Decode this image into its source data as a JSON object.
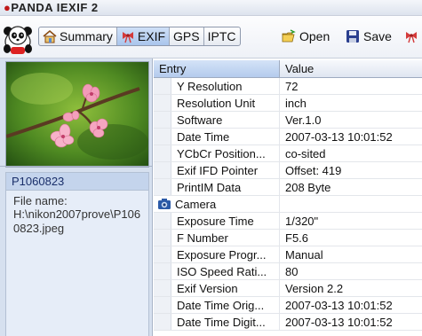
{
  "app": {
    "title_mark": "●",
    "title_text": "PANDA IEXIF 2"
  },
  "toolbar": {
    "tabs": [
      {
        "label": "Summary",
        "icon": "home-icon",
        "active": false
      },
      {
        "label": "EXIF",
        "icon": "exif-bow-icon",
        "active": true
      },
      {
        "label": "GPS",
        "icon": "",
        "active": false
      },
      {
        "label": "IPTC",
        "icon": "",
        "active": false
      }
    ],
    "open_label": "Open",
    "save_label": "Save"
  },
  "file": {
    "name": "P1060823",
    "path_label": "File name:",
    "path_value": "H:\\nikon2007prove\\P1060823.jpeg"
  },
  "table": {
    "col_entry": "Entry",
    "col_value": "Value",
    "rows": [
      {
        "key": "Y Resolution",
        "value": "72"
      },
      {
        "key": "Resolution Unit",
        "value": "inch"
      },
      {
        "key": "Software",
        "value": "Ver.1.0"
      },
      {
        "key": "Date Time",
        "value": "2007-03-13 10:01:52"
      },
      {
        "key": "YCbCr Position...",
        "value": "co-sited"
      },
      {
        "key": "Exif IFD Pointer",
        "value": "Offset: 419"
      },
      {
        "key": "PrintIM Data",
        "value": "208 Byte"
      },
      {
        "group": "Camera",
        "value": ""
      },
      {
        "key": "Exposure Time",
        "value": "1/320\""
      },
      {
        "key": "F Number",
        "value": "F5.6"
      },
      {
        "key": "Exposure Progr...",
        "value": "Manual"
      },
      {
        "key": "ISO Speed Rati...",
        "value": "80"
      },
      {
        "key": "Exif Version",
        "value": "Version 2.2"
      },
      {
        "key": "Date Time Orig...",
        "value": "2007-03-13 10:01:52"
      },
      {
        "key": "Date Time Digit...",
        "value": "2007-03-13 10:01:52"
      }
    ]
  },
  "colors": {
    "accent": "#c01818",
    "selected_tab": "#a9c5ec",
    "left_pane": "#d6e0ef"
  }
}
